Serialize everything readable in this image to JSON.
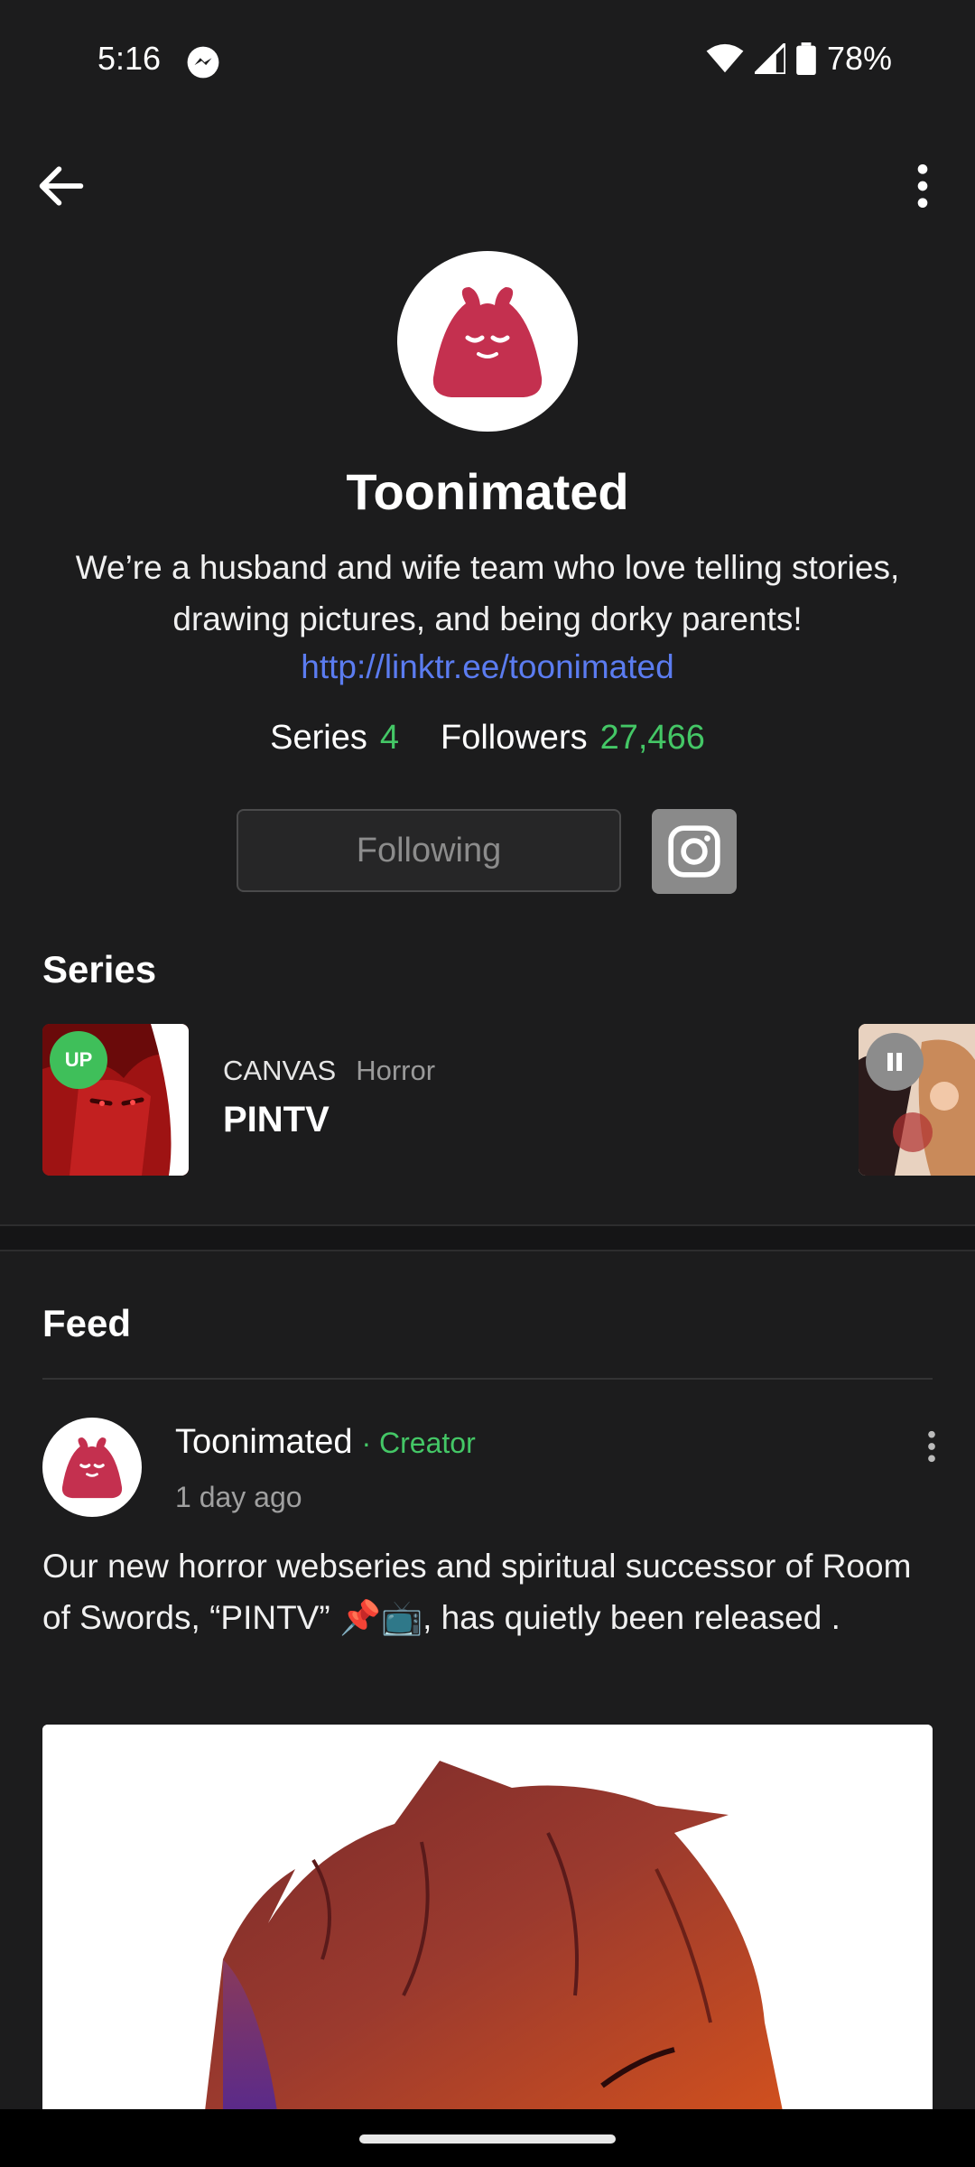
{
  "status_bar": {
    "time": "5:16",
    "battery": "78%",
    "icons": [
      "messenger-icon",
      "wifi-icon",
      "cell-signal-icon",
      "battery-icon"
    ]
  },
  "topbar": {
    "back_icon": "arrow-left-icon",
    "more_icon": "more-vert-icon"
  },
  "profile": {
    "name": "Toonimated",
    "bio": "We’re a husband and wife team who love telling stories, drawing pictures, and being dorky parents!",
    "link": "http://linktr.ee/toonimated",
    "stats": {
      "series_label": "Series",
      "series_value": "4",
      "followers_label": "Followers",
      "followers_value": "27,466"
    },
    "following_button": "Following",
    "social_icon": "instagram-icon"
  },
  "series_section": {
    "title": "Series",
    "items": [
      {
        "badge": "UP",
        "type": "CANVAS",
        "genre": "Horror",
        "name": "PINTV"
      }
    ],
    "next_item_badge_icon": "pause-icon"
  },
  "feed": {
    "title": "Feed",
    "post": {
      "author": "Toonimated",
      "role": "· Creator",
      "time": "1 day ago",
      "text": "Our new horror webseries and spiritual successor of Room of Swords, “PINTV” 📌📺, has quietly been released ."
    }
  },
  "colors": {
    "background": "#1c1c1d",
    "accent_green": "#44c766",
    "link_blue": "#5b7cf0",
    "avatar_brand": "#c4304f"
  }
}
